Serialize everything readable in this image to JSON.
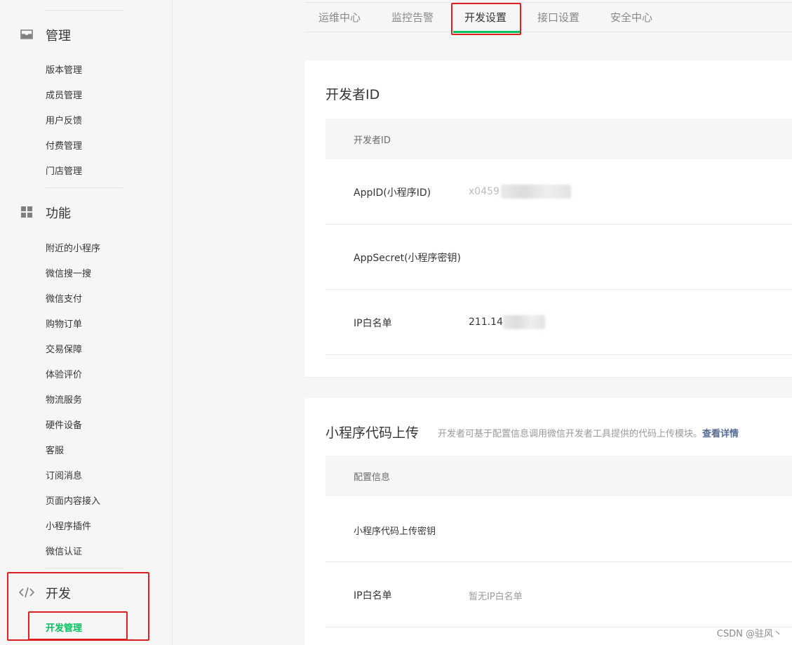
{
  "sidebar": {
    "groups": [
      {
        "title": "管理",
        "icon": "inbox-icon",
        "items": [
          "版本管理",
          "成员管理",
          "用户反馈",
          "付费管理",
          "门店管理"
        ]
      },
      {
        "title": "功能",
        "icon": "grid-icon",
        "items": [
          "附近的小程序",
          "微信搜一搜",
          "微信支付",
          "购物订单",
          "交易保障",
          "体验评价",
          "物流服务",
          "硬件设备",
          "客服",
          "订阅消息",
          "页面内容接入",
          "小程序插件",
          "微信认证"
        ]
      },
      {
        "title": "开发",
        "icon": "code-icon",
        "items": [
          "开发管理"
        ]
      }
    ],
    "active_item": "开发管理",
    "highlight_color": "#e02020",
    "active_color": "#07c160"
  },
  "tabs": {
    "items": [
      "运维中心",
      "监控告警",
      "开发设置",
      "接口设置",
      "安全中心"
    ],
    "active": "开发设置"
  },
  "developer_id_card": {
    "title": "开发者ID",
    "table_header": "开发者ID",
    "rows": [
      {
        "label": "AppID(小程序ID)",
        "value": "x0459"
      },
      {
        "label": "AppSecret(小程序密钥)",
        "value": ""
      },
      {
        "label": "IP白名单",
        "value": "211.14"
      }
    ]
  },
  "upload_card": {
    "title": "小程序代码上传",
    "subtitle": "开发者可基于配置信息调用微信开发者工具提供的代码上传模块。",
    "link_text": "查看详情",
    "table_header": "配置信息",
    "rows": [
      {
        "label": "小程序代码上传密钥",
        "value": ""
      },
      {
        "label": "IP白名单",
        "value": "暂无IP白名单"
      }
    ]
  },
  "watermark": "CSDN @驻风丶"
}
